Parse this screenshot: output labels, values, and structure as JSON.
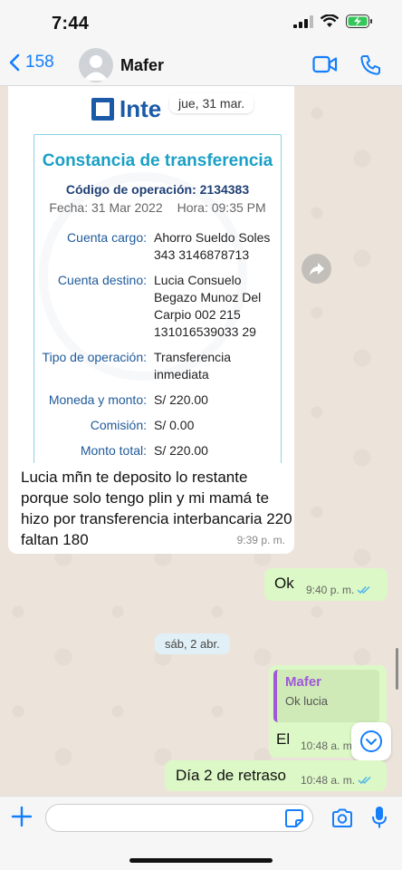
{
  "status": {
    "time": "7:44"
  },
  "header": {
    "back_count": "158",
    "contact_name": "Mafer"
  },
  "receipt": {
    "logo_text": "Inte",
    "date_pill": "jue, 31 mar.",
    "title": "Constancia de transferencia",
    "op_code": "Código de operación: 2134383",
    "date": "Fecha: 31 Mar 2022",
    "hour": "Hora: 09:35 PM",
    "rows": [
      {
        "label": "Cuenta cargo:",
        "value": "Ahorro Sueldo Soles 343 3146878713"
      },
      {
        "label": "Cuenta destino:",
        "value": "Lucia Consuelo Begazo Munoz Del Carpio 002 215 131016539033 29"
      },
      {
        "label": "Tipo de operación:",
        "value": "Transferencia inmediata"
      },
      {
        "label": "Moneda y monto:",
        "value": "S/ 220.00"
      },
      {
        "label": "Comisión:",
        "value": "S/ 0.00"
      },
      {
        "label": "Monto total:",
        "value": "S/ 220.00"
      }
    ]
  },
  "messages": {
    "incoming_text": "Lucia mñn te deposito lo restante porque solo tengo plin y mi mamá te hizo por transferencia interbancaria 220 faltan 180",
    "incoming_time": "9:39 p. m.",
    "ok_text": "Ok",
    "ok_time": "9:40 p. m.",
    "day_separator": "sáb, 2 abr.",
    "quote_name": "Mafer",
    "quote_text": "Ok lucia",
    "reply_text": "El",
    "reply_time": "10:48 a. m.",
    "last_text": "Día 2 de retraso",
    "last_time": "10:48 a. m."
  },
  "input": {
    "placeholder": ""
  },
  "colors": {
    "accent": "#147efb",
    "outgoing": "#dcf8c6",
    "quote_bar": "#a158d9",
    "receipt_title": "#1aa0c6"
  }
}
